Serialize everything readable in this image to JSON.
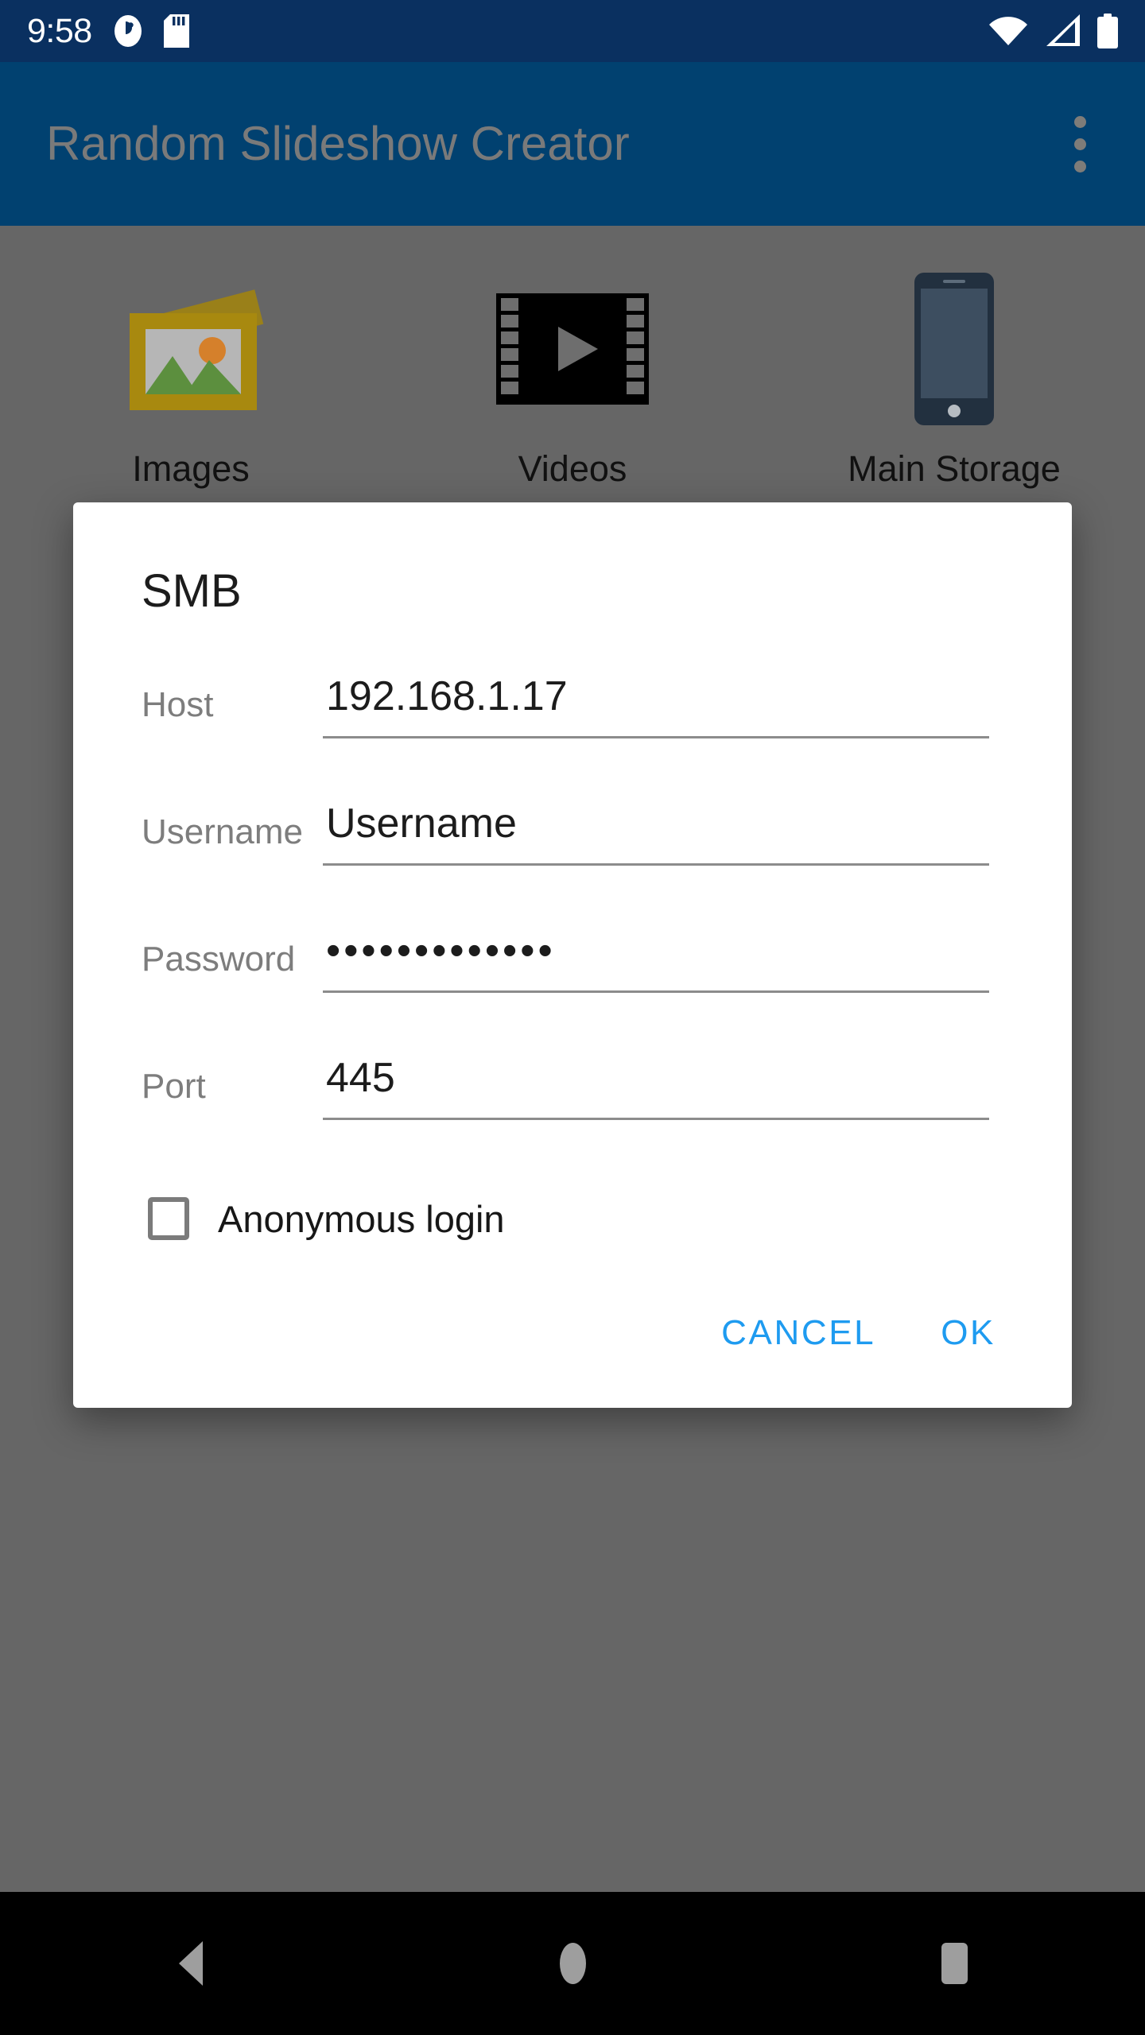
{
  "status_bar": {
    "time": "9:58",
    "left_icons": [
      "do-not-disturb-icon",
      "sd-card-icon"
    ],
    "right_icons": [
      "wifi-icon",
      "cellular-signal-icon",
      "battery-icon"
    ],
    "background_color": "#0a3060"
  },
  "app_bar": {
    "title": "Random Slideshow Creator",
    "overflow_icon": "more-vert-icon",
    "background_color": "#014170",
    "title_color": "#7a7a7a"
  },
  "content": {
    "tiles": [
      {
        "label": "Images",
        "icon": "photo-library-icon"
      },
      {
        "label": "Videos",
        "icon": "movie-film-icon"
      },
      {
        "label": "Main Storage",
        "icon": "smartphone-icon"
      }
    ],
    "scrim_color": "#666666"
  },
  "dialog": {
    "title": "SMB",
    "fields": [
      {
        "label": "Host",
        "value": "192.168.1.17",
        "placeholder": "Host",
        "type": "text"
      },
      {
        "label": "Username",
        "value": "Username",
        "placeholder": "Username",
        "type": "text"
      },
      {
        "label": "Password",
        "value": "•••••••••••••",
        "placeholder": "Password",
        "type": "password"
      },
      {
        "label": "Port",
        "value": "445",
        "placeholder": "Port",
        "type": "number"
      }
    ],
    "checkbox": {
      "label": "Anonymous login",
      "checked": false
    },
    "actions": {
      "cancel_label": "CANCEL",
      "ok_label": "OK",
      "accent_color": "#1e9bf0"
    }
  },
  "nav_bar": {
    "back_label": "Back",
    "home_label": "Home",
    "recents_label": "Recents",
    "background_color": "#000000"
  }
}
